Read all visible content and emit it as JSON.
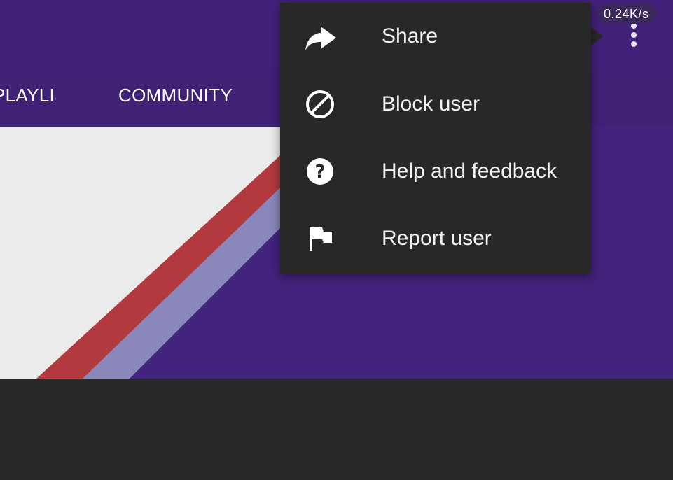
{
  "header": {
    "tabs": [
      {
        "label": "PLAYLISTS"
      },
      {
        "label": "COMMUNITY"
      }
    ],
    "network_speed": "0.24K/s",
    "more_icon": "more-vert-icon"
  },
  "menu": {
    "items": [
      {
        "label": "Share",
        "icon": "share-icon"
      },
      {
        "label": "Block user",
        "icon": "block-icon"
      },
      {
        "label": "Help and feedback",
        "icon": "help-icon"
      },
      {
        "label": "Report user",
        "icon": "flag-icon"
      }
    ]
  },
  "colors": {
    "header_bg": "#412179",
    "menu_bg": "#282828",
    "stripe_red": "#b23a3e",
    "stripe_lavender": "#8a87bb",
    "banner_light": "#ebebeb"
  }
}
